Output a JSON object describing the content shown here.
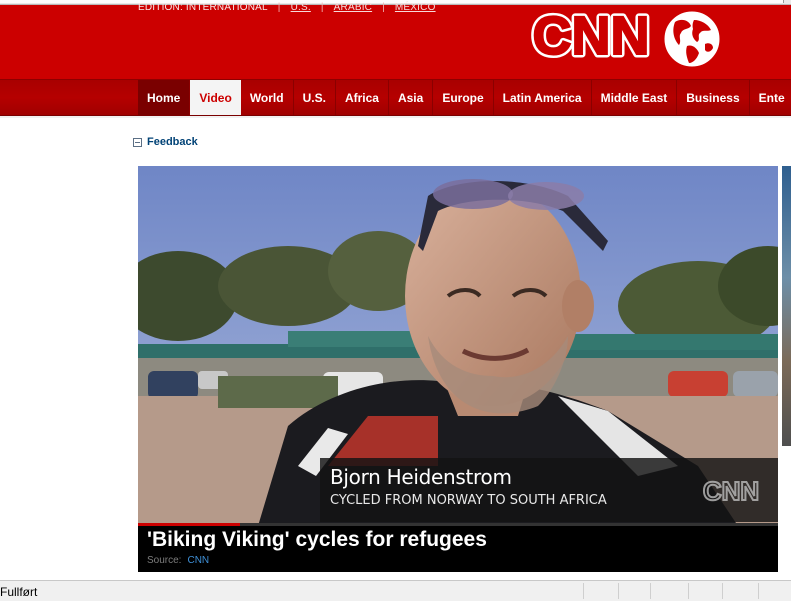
{
  "browser": {
    "status_text": "Fullført"
  },
  "header": {
    "edition_label": "EDITION: INTERNATIONAL",
    "edition_links": [
      "U.S.",
      "ARABIC",
      "MÉXICO"
    ],
    "logo_text": "CNN",
    "brand_color": "#cc0000"
  },
  "nav": {
    "items": [
      {
        "label": "Home"
      },
      {
        "label": "Video"
      },
      {
        "label": "World"
      },
      {
        "label": "U.S."
      },
      {
        "label": "Africa"
      },
      {
        "label": "Asia"
      },
      {
        "label": "Europe"
      },
      {
        "label": "Latin America"
      },
      {
        "label": "Middle East"
      },
      {
        "label": "Business"
      },
      {
        "label": "Ente"
      }
    ],
    "active": "Video"
  },
  "feedback": {
    "label": "Feedback"
  },
  "video": {
    "lower_third_name": "Bjorn Heidenstrom",
    "lower_third_subline": "CYCLED FROM NORWAY TO SOUTH AFRICA",
    "title": "'Biking Viking' cycles for refugees",
    "source_label": "Source:",
    "source_value": "CNN",
    "progress_fraction": 0.16
  }
}
